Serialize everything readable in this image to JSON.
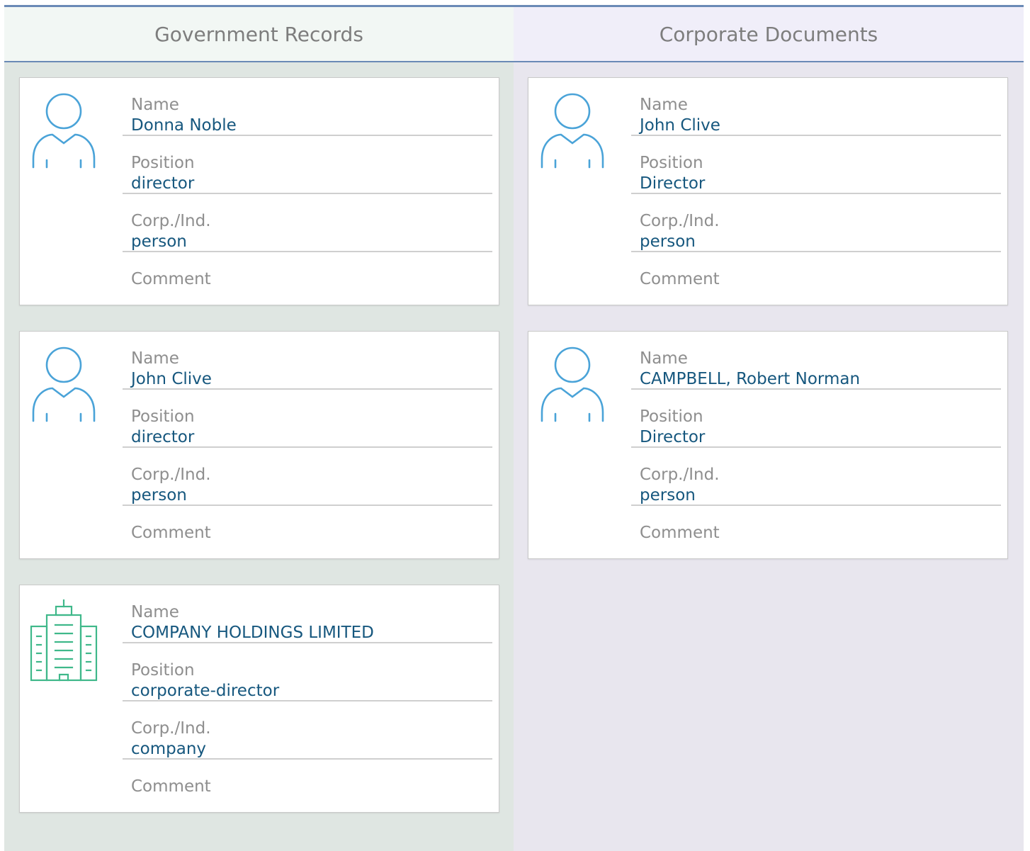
{
  "columns": {
    "left_title": "Government Records",
    "right_title": "Corporate Documents"
  },
  "labels": {
    "name": "Name",
    "position": "Position",
    "corp_ind": "Corp./Ind.",
    "comment": "Comment"
  },
  "government_records": [
    {
      "icon": "person-icon",
      "name": "Donna Noble",
      "position": "director",
      "corp_ind": "person",
      "comment": ""
    },
    {
      "icon": "person-icon",
      "name": "John Clive",
      "position": "director",
      "corp_ind": "person",
      "comment": ""
    },
    {
      "icon": "building-icon",
      "name": "COMPANY HOLDINGS LIMITED",
      "position": "corporate-director",
      "corp_ind": "company",
      "comment": ""
    }
  ],
  "corporate_documents": [
    {
      "icon": "person-icon",
      "name": "John Clive",
      "position": "Director",
      "corp_ind": "person",
      "comment": ""
    },
    {
      "icon": "person-icon",
      "name": "CAMPBELL, Robert Norman",
      "position": "Director",
      "corp_ind": "person",
      "comment": ""
    }
  ],
  "colors": {
    "accent": "#6a8ab6",
    "person_icon": "#4aa3d8",
    "building_icon": "#3fb88a",
    "value_text": "#16577e",
    "label_text": "#8e8e8e"
  }
}
